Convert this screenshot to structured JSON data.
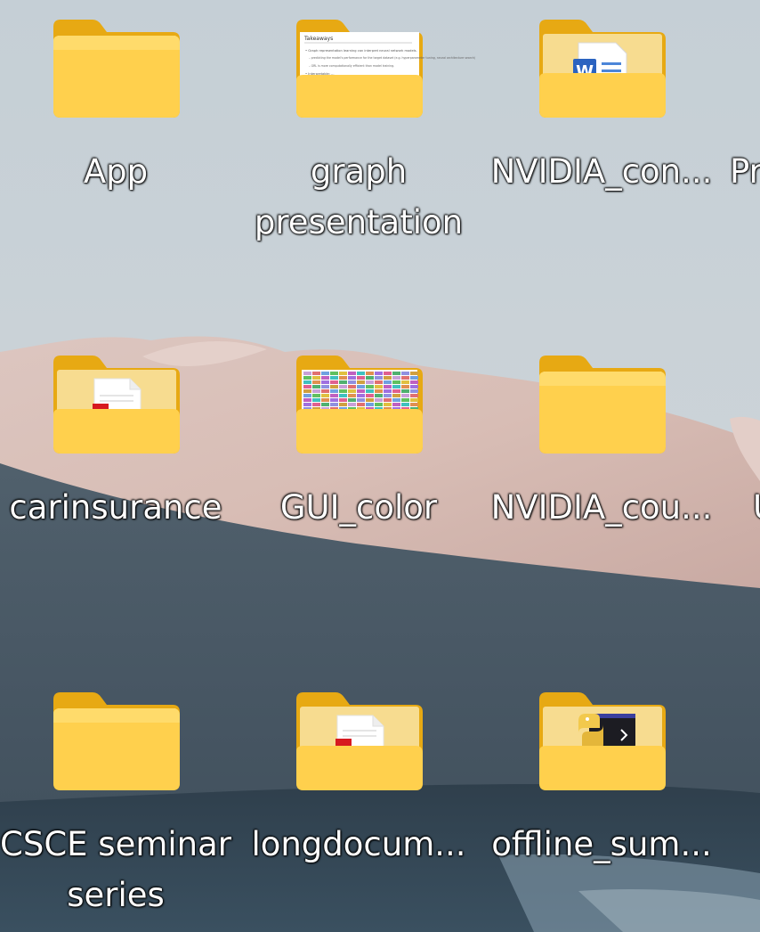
{
  "desktop": {
    "icons": [
      {
        "name": "App",
        "line1": "App",
        "line2": "",
        "thumb": "empty"
      },
      {
        "name": "graph presentation",
        "line1": "graph",
        "line2": "presentation",
        "thumb": "slide"
      },
      {
        "name": "NVIDIA_con...",
        "line1": "NVIDIA_con...",
        "line2": "",
        "thumb": "word"
      },
      {
        "name": "carinsurance",
        "line1": "carinsurance",
        "line2": "",
        "thumb": "pdf"
      },
      {
        "name": "GUI_color",
        "line1": "GUI_color",
        "line2": "",
        "thumb": "palette"
      },
      {
        "name": "NVIDIA_cou...",
        "line1": "NVIDIA_cou...",
        "line2": "",
        "thumb": "empty"
      },
      {
        "name": "CSCE seminar series",
        "line1": "CSCE seminar",
        "line2": "series",
        "thumb": "empty"
      },
      {
        "name": "longdocum...",
        "line1": "longdocum...",
        "line2": "",
        "thumb": "pdf"
      },
      {
        "name": "offline_sum...",
        "line1": "offline_sum...",
        "line2": "",
        "thumb": "python"
      }
    ],
    "partial": [
      {
        "text": "Pr"
      },
      {
        "text": "U"
      }
    ],
    "slide_text": {
      "title": "Takeaways",
      "b1": "• Graph representation learning can interpret neural network models.",
      "b2": "– predicting the model's performance for the target dataset (e.g. hyperparameter tuning, neural architecture search)",
      "b3": "– GRL is more computationally efficient than model training.",
      "b4": "• Interpretable: ..."
    },
    "word_letter": "W"
  }
}
